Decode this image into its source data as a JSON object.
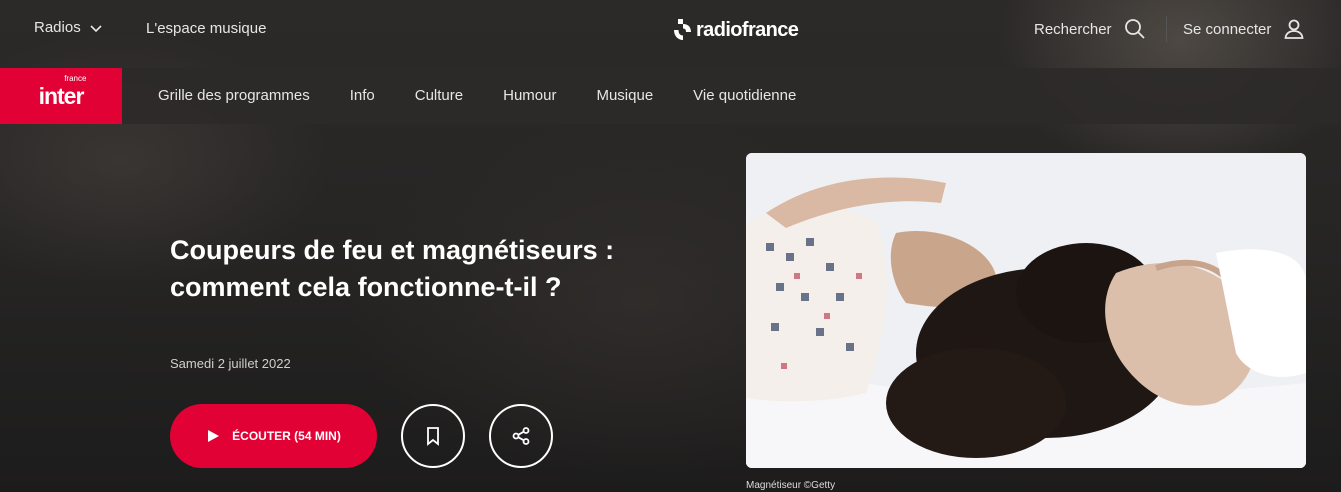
{
  "topbar": {
    "radios_label": "Radios",
    "espace_label": "L'espace musique",
    "brand": "radiofrance",
    "search_label": "Rechercher",
    "login_label": "Se connecter"
  },
  "nav": {
    "station_word": "inter",
    "station_tag": "france",
    "items": [
      "Grille des programmes",
      "Info",
      "Culture",
      "Humour",
      "Musique",
      "Vie quotidienne"
    ]
  },
  "episode": {
    "title": "Coupeurs de feu et magnétiseurs : comment cela fonctionne-t-il ?",
    "date": "Samedi 2 juillet 2022",
    "listen_label": "ÉCOUTER (54 MIN)",
    "image_caption": "Magnétiseur ©Getty"
  },
  "colors": {
    "accent": "#e20134",
    "background": "#262524",
    "nav_background": "#2c2a29"
  },
  "icons": {
    "radios": "chevron-down-icon",
    "search": "search-icon",
    "login": "user-icon",
    "listen": "play-icon",
    "bookmark": "bookmark-icon",
    "share": "share-icon"
  }
}
